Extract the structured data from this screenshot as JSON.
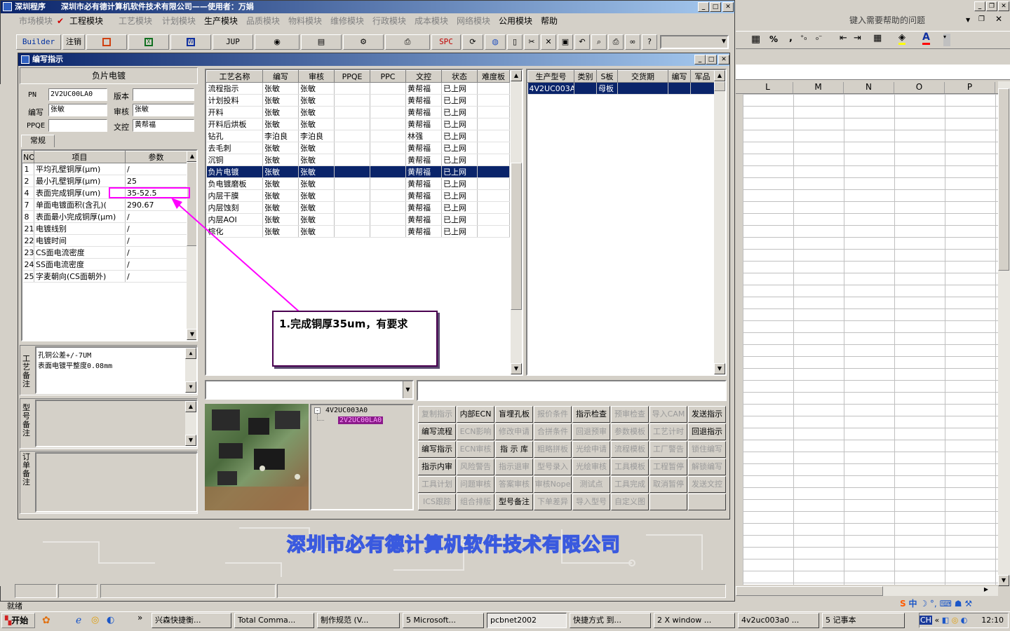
{
  "app": {
    "title": "深圳程序",
    "subtitle": "深圳市必有德计算机软件技术有限公司——使用者：万娟"
  },
  "menu": [
    {
      "label": "市场模块",
      "enabled": false
    },
    {
      "label": "工程模块",
      "enabled": true
    },
    {
      "label": "工艺模块",
      "enabled": false
    },
    {
      "label": "计划模块",
      "enabled": false
    },
    {
      "label": "生产模块",
      "enabled": true
    },
    {
      "label": "品质模块",
      "enabled": false
    },
    {
      "label": "物料模块",
      "enabled": false
    },
    {
      "label": "维修模块",
      "enabled": false
    },
    {
      "label": "行政模块",
      "enabled": false
    },
    {
      "label": "成本模块",
      "enabled": false
    },
    {
      "label": "网络模块",
      "enabled": false
    },
    {
      "label": "公用模块",
      "enabled": true
    },
    {
      "label": "帮助",
      "enabled": true
    }
  ],
  "toolbar": {
    "builder": "Builder",
    "logout": "注销",
    "jup": "JUP",
    "spc": "SPC"
  },
  "excel": {
    "help_placeholder": "键入需要帮助的问题",
    "columns": [
      "L",
      "M",
      "N",
      "O",
      "P"
    ],
    "percent": "%",
    "comma": ","
  },
  "dialog": {
    "title": "编写指示",
    "process_name": "负片电镀",
    "labels": {
      "pn": "PN",
      "version": "版本",
      "writer": "编写",
      "reviewer": "审核",
      "ppqe": "PPQE",
      "doc": "文控"
    },
    "values": {
      "pn": "2V2UC00LA0",
      "version": "",
      "writer": "张敏",
      "reviewer": "张敏",
      "ppqe": "",
      "doc": "黄帮福"
    },
    "tab": "常规",
    "param_headers": [
      "NO",
      "项目",
      "参数"
    ],
    "params": [
      {
        "no": "1",
        "item": "平均孔壁铜厚(μm)",
        "value": "/"
      },
      {
        "no": "2",
        "item": "最小孔壁铜厚(μm)",
        "value": "25"
      },
      {
        "no": "4",
        "item": "表面完成铜厚(um)",
        "value": "35-52.5"
      },
      {
        "no": "7",
        "item": "单面电镀面积(含孔)(",
        "value": "290.67"
      },
      {
        "no": "8",
        "item": "表面最小完成铜厚(μm)",
        "value": "/"
      },
      {
        "no": "21",
        "item": "电镀线别",
        "value": "/"
      },
      {
        "no": "22",
        "item": "电镀时间",
        "value": "/"
      },
      {
        "no": "23",
        "item": "CS面电流密度",
        "value": "/"
      },
      {
        "no": "24",
        "item": "SS面电流密度",
        "value": "/"
      },
      {
        "no": "25",
        "item": "字麦朝向(CS面朝外)",
        "value": "/"
      }
    ],
    "notes": {
      "process_label": "工艺备注",
      "process_text_1": "孔铜公差+/-7UM",
      "process_text_2": "表面电镀平整度0.08mm",
      "model_label": "型号备注",
      "order_label": "订单备注"
    },
    "process_headers": [
      "工艺名称",
      "编写",
      "审核",
      "PPQE",
      "PPC",
      "文控",
      "状态",
      "难度板"
    ],
    "processes": [
      {
        "name": "流程指示",
        "writer": "张敏",
        "reviewer": "张敏",
        "ppqe": "",
        "ppc": "",
        "doc": "黄帮福",
        "status": "已上网",
        "difficulty": ""
      },
      {
        "name": "计划投料",
        "writer": "张敏",
        "reviewer": "张敏",
        "ppqe": "",
        "ppc": "",
        "doc": "黄帮福",
        "status": "已上网",
        "difficulty": ""
      },
      {
        "name": "开料",
        "writer": "张敏",
        "reviewer": "张敏",
        "ppqe": "",
        "ppc": "",
        "doc": "黄帮福",
        "status": "已上网",
        "difficulty": ""
      },
      {
        "name": "开料后烘板",
        "writer": "张敏",
        "reviewer": "张敏",
        "ppqe": "",
        "ppc": "",
        "doc": "黄帮福",
        "status": "已上网",
        "difficulty": ""
      },
      {
        "name": "钻孔",
        "writer": "李泊良",
        "reviewer": "李泊良",
        "ppqe": "",
        "ppc": "",
        "doc": "林强",
        "status": "已上网",
        "difficulty": ""
      },
      {
        "name": "去毛刺",
        "writer": "张敏",
        "reviewer": "张敏",
        "ppqe": "",
        "ppc": "",
        "doc": "黄帮福",
        "status": "已上网",
        "difficulty": ""
      },
      {
        "name": "沉铜",
        "writer": "张敏",
        "reviewer": "张敏",
        "ppqe": "",
        "ppc": "",
        "doc": "黄帮福",
        "status": "已上网",
        "difficulty": ""
      },
      {
        "name": "负片电镀",
        "writer": "张敏",
        "reviewer": "张敏",
        "ppqe": "",
        "ppc": "",
        "doc": "黄帮福",
        "status": "已上网",
        "difficulty": ""
      },
      {
        "name": "负电镀磨板",
        "writer": "张敏",
        "reviewer": "张敏",
        "ppqe": "",
        "ppc": "",
        "doc": "黄帮福",
        "status": "已上网",
        "difficulty": ""
      },
      {
        "name": "内层干膜",
        "writer": "张敏",
        "reviewer": "张敏",
        "ppqe": "",
        "ppc": "",
        "doc": "黄帮福",
        "status": "已上网",
        "difficulty": ""
      },
      {
        "name": "内层蚀刻",
        "writer": "张敏",
        "reviewer": "张敏",
        "ppqe": "",
        "ppc": "",
        "doc": "黄帮福",
        "status": "已上网",
        "difficulty": ""
      },
      {
        "name": "内层AOI",
        "writer": "张敏",
        "reviewer": "张敏",
        "ppqe": "",
        "ppc": "",
        "doc": "黄帮福",
        "status": "已上网",
        "difficulty": ""
      },
      {
        "name": "棕化",
        "writer": "张敏",
        "reviewer": "张敏",
        "ppqe": "",
        "ppc": "",
        "doc": "黄帮福",
        "status": "已上网",
        "difficulty": ""
      }
    ],
    "model_headers": [
      "生产型号",
      "类别",
      "S板",
      "交货期",
      "编写",
      "军品"
    ],
    "models": [
      {
        "model": "4V2UC003A0",
        "type": "",
        "s_board": "母板",
        "due": "",
        "writer": "",
        "military": ""
      }
    ],
    "tree": {
      "root": "4V2UC003A0",
      "child": "2V2UC00LA0"
    },
    "actions": [
      [
        "复制指示",
        "内部ECN",
        "盲埋孔板",
        "报价条件",
        "指示检查",
        "预审检查",
        "导入CAM",
        "发送指示"
      ],
      [
        "编写流程",
        "ECN影响",
        "修改申请",
        "合拼条件",
        "回退预审",
        "参数模板",
        "工艺计时",
        "回退指示"
      ],
      [
        "编写指示",
        "ECN审核",
        "指 示 库",
        "粗略拼板",
        "光绘申请",
        "流程模板",
        "工厂警告",
        "锁住编写"
      ],
      [
        "指示内审",
        "风险警告",
        "指示退审",
        "型号录入",
        "光绘审核",
        "工具模板",
        "工程暂停",
        "解锁编写"
      ],
      [
        "工具计划",
        "问题审核",
        "答案审核",
        "审核Nope",
        "测试点",
        "工具完成",
        "取消暂停",
        "发送文控"
      ],
      [
        "ICS跟踪",
        "组合排版",
        "型号备注",
        "下单差异",
        "导入型号",
        "自定义图",
        "",
        ""
      ]
    ],
    "actions_enabled": [
      [
        false,
        true,
        true,
        false,
        true,
        false,
        false,
        true
      ],
      [
        true,
        false,
        false,
        false,
        false,
        false,
        false,
        true
      ],
      [
        true,
        false,
        true,
        false,
        false,
        false,
        false,
        false
      ],
      [
        true,
        false,
        false,
        false,
        false,
        false,
        false,
        false
      ],
      [
        false,
        false,
        false,
        false,
        false,
        false,
        false,
        false
      ],
      [
        false,
        false,
        true,
        false,
        false,
        false,
        false,
        false
      ]
    ]
  },
  "annotation": {
    "text": "1.完成铜厚35um，有要求"
  },
  "watermark": "深圳市必有德计算机软件技术有限公司",
  "status": {
    "left": "就绪"
  },
  "taskbar": {
    "start": "开始",
    "items": [
      "兴森快捷衡...",
      "Total Comma...",
      "制作规范 (V...",
      "5 Microsoft...",
      "pcbnet2002",
      "快捷方式 到...",
      "2 X window ...",
      "4v2uc003a0 ...",
      "5 记事本"
    ],
    "tray_lang": "CH",
    "clock": "12:10",
    "ime": "中"
  },
  "colors": {
    "titlebar": "#0a246a",
    "selection": "#0a246a",
    "annotation_arrow": "#ff00ff",
    "annotation_border": "#4a0050",
    "watermark": "#3a5adf",
    "tree_highlight": "#8b1a8b"
  }
}
